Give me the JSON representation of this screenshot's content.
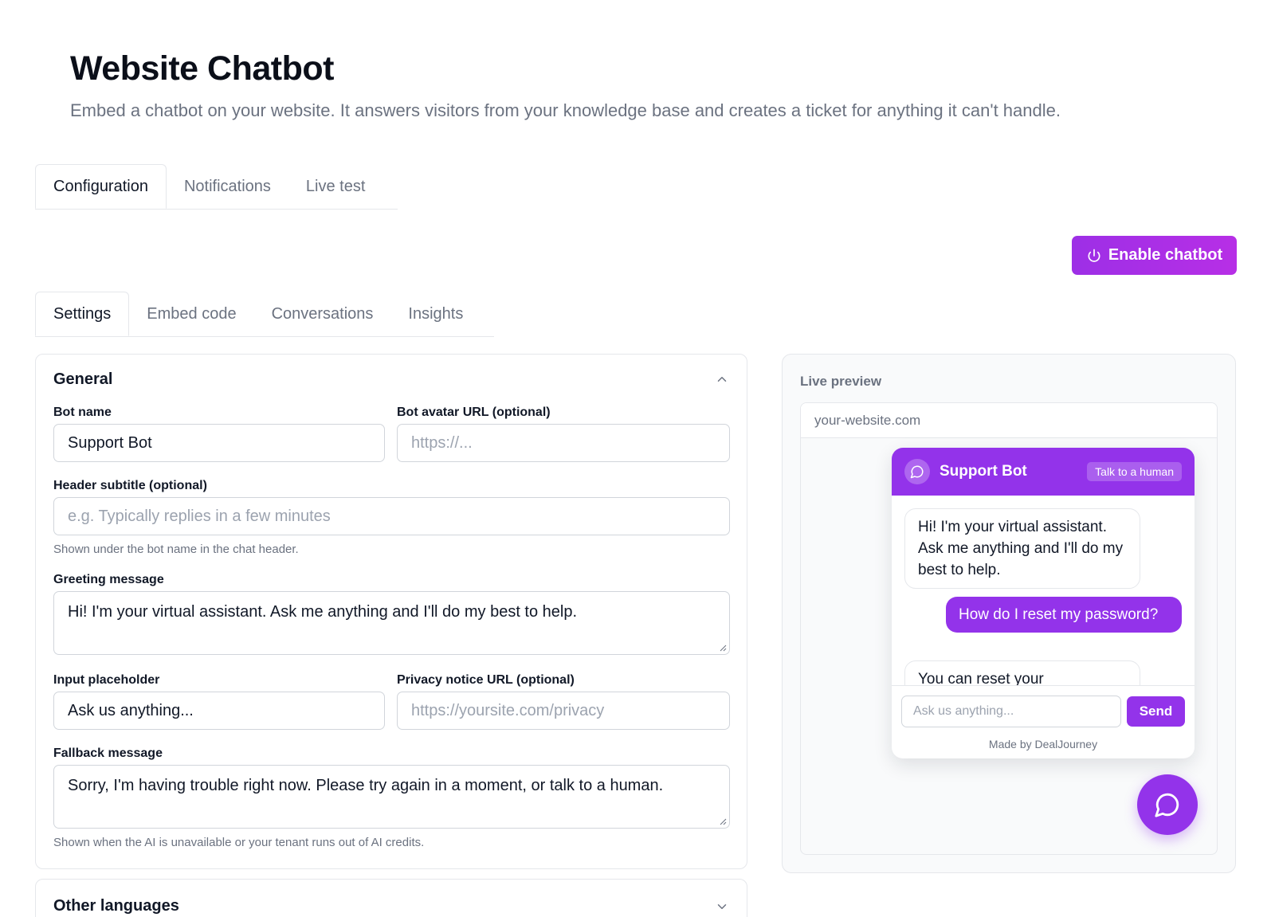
{
  "page": {
    "title": "Website Chatbot",
    "description": "Embed a chatbot on your website. It answers visitors from your knowledge base and creates a ticket for anything it can't handle."
  },
  "main_tabs": [
    {
      "label": "Configuration",
      "active": true
    },
    {
      "label": "Notifications",
      "active": false
    },
    {
      "label": "Live test",
      "active": false
    }
  ],
  "enable_button": {
    "label": "Enable chatbot",
    "icon": "power-icon"
  },
  "sub_tabs": [
    {
      "label": "Settings",
      "active": true
    },
    {
      "label": "Embed code",
      "active": false
    },
    {
      "label": "Conversations",
      "active": false
    },
    {
      "label": "Insights",
      "active": false
    }
  ],
  "general": {
    "title": "General",
    "expanded": true,
    "bot_name": {
      "label": "Bot name",
      "value": "Support Bot"
    },
    "bot_avatar": {
      "label": "Bot avatar URL (optional)",
      "placeholder": "https://..."
    },
    "header_subtitle": {
      "label": "Header subtitle (optional)",
      "placeholder": "e.g. Typically replies in a few minutes",
      "help": "Shown under the bot name in the chat header."
    },
    "greeting": {
      "label": "Greeting message",
      "value": "Hi! I'm your virtual assistant. Ask me anything and I'll do my best to help."
    },
    "input_placeholder": {
      "label": "Input placeholder",
      "value": "Ask us anything..."
    },
    "privacy_url": {
      "label": "Privacy notice URL (optional)",
      "placeholder": "https://yoursite.com/privacy"
    },
    "fallback": {
      "label": "Fallback message",
      "value": "Sorry, I'm having trouble right now. Please try again in a moment, or talk to a human.",
      "help": "Shown when the AI is unavailable or your tenant runs out of AI credits."
    }
  },
  "other_languages": {
    "title": "Other languages",
    "expanded": false
  },
  "preview": {
    "label": "Live preview",
    "url": "your-website.com",
    "widget": {
      "bot_name": "Support Bot",
      "talk_to_human": "Talk to a human",
      "messages": [
        {
          "from": "bot",
          "text": "Hi! I'm your virtual assistant. Ask me anything and I'll do my best to help."
        },
        {
          "from": "user",
          "text": "How do I reset my password?"
        },
        {
          "from": "bot",
          "text": "You can reset your"
        }
      ],
      "input_placeholder": "Ask us anything...",
      "send_label": "Send",
      "footer": "Made by DealJourney"
    }
  },
  "colors": {
    "accent": "#9333ea",
    "text": "#111827",
    "muted": "#6b7280",
    "border": "#e5e7eb"
  }
}
